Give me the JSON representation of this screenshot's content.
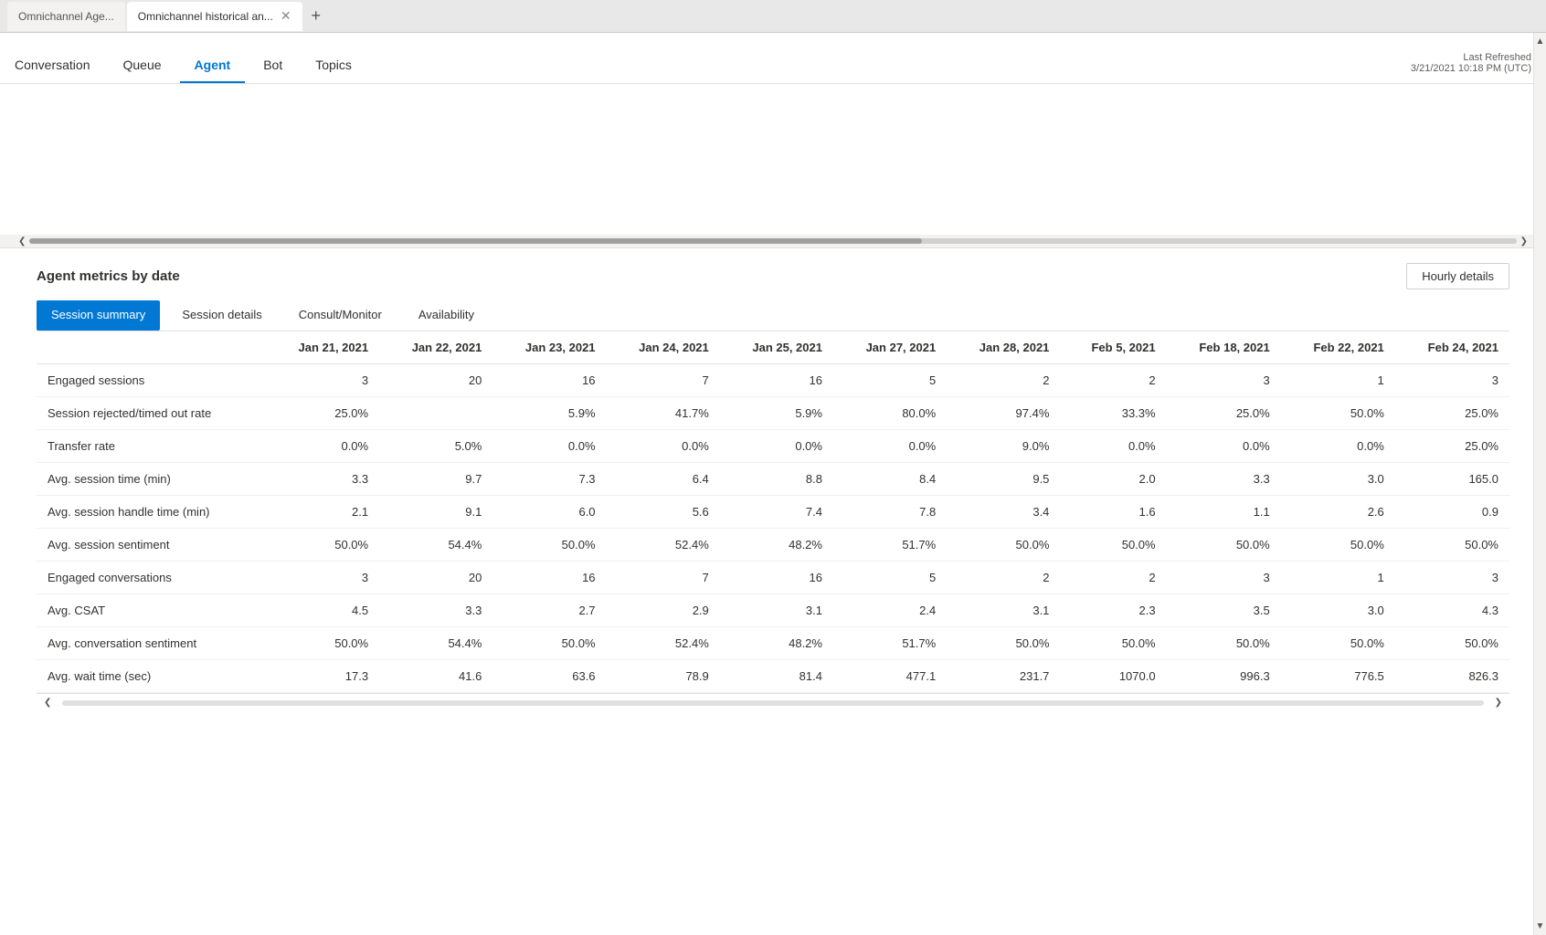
{
  "browser": {
    "tabs": [
      {
        "label": "Omnichannel Age...",
        "active": false
      },
      {
        "label": "Omnichannel historical an...",
        "active": true
      }
    ],
    "add_tab_label": "+"
  },
  "nav": {
    "items": [
      {
        "label": "Conversation",
        "active": false
      },
      {
        "label": "Queue",
        "active": false
      },
      {
        "label": "Agent",
        "active": true
      },
      {
        "label": "Bot",
        "active": false
      },
      {
        "label": "Topics",
        "active": false
      }
    ],
    "last_refreshed_label": "Last Refreshed",
    "last_refreshed_value": "3/21/2021 10:18 PM (UTC)"
  },
  "section": {
    "title": "Agent metrics by date",
    "hourly_button": "Hourly details",
    "sub_tabs": [
      {
        "label": "Session summary",
        "active": true
      },
      {
        "label": "Session details",
        "active": false
      },
      {
        "label": "Consult/Monitor",
        "active": false
      },
      {
        "label": "Availability",
        "active": false
      }
    ]
  },
  "table": {
    "columns": [
      "",
      "Jan 21, 2021",
      "Jan 22, 2021",
      "Jan 23, 2021",
      "Jan 24, 2021",
      "Jan 25, 2021",
      "Jan 27, 2021",
      "Jan 28, 2021",
      "Feb 5, 2021",
      "Feb 18, 2021",
      "Feb 22, 2021",
      "Feb 24, 2021"
    ],
    "rows": [
      {
        "label": "Engaged sessions",
        "values": [
          "3",
          "20",
          "16",
          "7",
          "16",
          "5",
          "2",
          "2",
          "3",
          "1",
          "3"
        ]
      },
      {
        "label": "Session rejected/timed out rate",
        "values": [
          "25.0%",
          "",
          "5.9%",
          "41.7%",
          "5.9%",
          "80.0%",
          "97.4%",
          "33.3%",
          "25.0%",
          "50.0%",
          "25.0%"
        ]
      },
      {
        "label": "Transfer rate",
        "values": [
          "0.0%",
          "5.0%",
          "0.0%",
          "0.0%",
          "0.0%",
          "0.0%",
          "9.0%",
          "0.0%",
          "0.0%",
          "0.0%",
          "25.0%"
        ]
      },
      {
        "label": "Avg. session time (min)",
        "values": [
          "3.3",
          "9.7",
          "7.3",
          "6.4",
          "8.8",
          "8.4",
          "9.5",
          "2.0",
          "3.3",
          "3.0",
          "165.0"
        ]
      },
      {
        "label": "Avg. session handle time (min)",
        "values": [
          "2.1",
          "9.1",
          "6.0",
          "5.6",
          "7.4",
          "7.8",
          "3.4",
          "1.6",
          "1.1",
          "2.6",
          "0.9"
        ]
      },
      {
        "label": "Avg. session sentiment",
        "values": [
          "50.0%",
          "54.4%",
          "50.0%",
          "52.4%",
          "48.2%",
          "51.7%",
          "50.0%",
          "50.0%",
          "50.0%",
          "50.0%",
          "50.0%"
        ]
      },
      {
        "label": "Engaged conversations",
        "values": [
          "3",
          "20",
          "16",
          "7",
          "16",
          "5",
          "2",
          "2",
          "3",
          "1",
          "3"
        ]
      },
      {
        "label": "Avg. CSAT",
        "values": [
          "4.5",
          "3.3",
          "2.7",
          "2.9",
          "3.1",
          "2.4",
          "3.1",
          "2.3",
          "3.5",
          "3.0",
          "4.3"
        ]
      },
      {
        "label": "Avg. conversation sentiment",
        "values": [
          "50.0%",
          "54.4%",
          "50.0%",
          "52.4%",
          "48.2%",
          "51.7%",
          "50.0%",
          "50.0%",
          "50.0%",
          "50.0%",
          "50.0%"
        ]
      },
      {
        "label": "Avg. wait time (sec)",
        "values": [
          "17.3",
          "41.6",
          "63.6",
          "78.9",
          "81.4",
          "477.1",
          "231.7",
          "1070.0",
          "996.3",
          "776.5",
          "826.3"
        ]
      }
    ]
  }
}
